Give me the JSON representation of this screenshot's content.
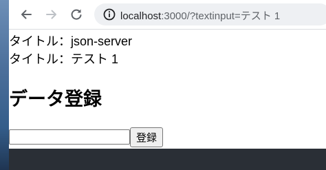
{
  "browser": {
    "url_host": "localhost",
    "url_rest": ":3000/?textinput=テスト 1"
  },
  "page": {
    "title_line_1": "タイトル：json-server",
    "title_line_2": "タイトル：テスト 1",
    "heading": "データ登録",
    "text_input_value": "",
    "submit_label": "登録"
  },
  "icons": {
    "back": "arrow-left-icon",
    "forward": "arrow-right-icon",
    "reload": "reload-icon",
    "site_info": "info-icon"
  }
}
